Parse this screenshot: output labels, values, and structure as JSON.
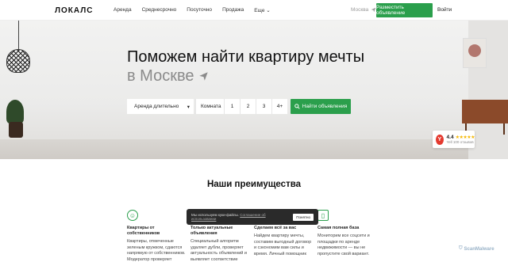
{
  "brand": {
    "logo": "ЛОКАЛС"
  },
  "nav": {
    "items": [
      "Аренда",
      "Среднесрочно",
      "Посуточно",
      "Продажа",
      "Еще"
    ],
    "city": "Москва",
    "post_ad": "Разместить объявление",
    "login": "Войти"
  },
  "hero": {
    "title": "Поможем найти квартиру мечты",
    "subtitle": "в Москве"
  },
  "search": {
    "rent_type": "Аренда длительно",
    "room_label": "Комната",
    "room_counts": [
      "1",
      "2",
      "3",
      "4+"
    ],
    "button": "Найти объявления"
  },
  "rating": {
    "score": "4.4",
    "stars": "★★★★★",
    "source": "Yell",
    "reviews": "100 отзывов"
  },
  "advantages": {
    "title": "Наши преимущества",
    "items": [
      {
        "title": "Квартиры от собственников",
        "text": "Квартиры, отмеченные зеленым кружком, сдаются напрямую от собственников. Модератор проверяет"
      },
      {
        "title": "Только актуальные объявления",
        "text": "Специальный алгоритм удаляет дубли, проверяет актуальность объявлений и выявляет соответствие"
      },
      {
        "title": "Сделаем всё за вас",
        "text": "Найдем квартиру мечты, составим выгодный договор и сэкономим вам силы и время. Личный помощник"
      },
      {
        "title": "Самая полная база",
        "text": "Мониторим все соцсети и площадки по аренде недвижимости — вы не пропустите свой вариант."
      }
    ]
  },
  "cookie": {
    "text": "Мы используем куки-файлы.",
    "link": "Соглашение об использовании",
    "button": "Понятно"
  },
  "watermark": "ScanMalware",
  "colors": {
    "accent": "#2b9f4c",
    "dark": "#2a2a2a"
  }
}
